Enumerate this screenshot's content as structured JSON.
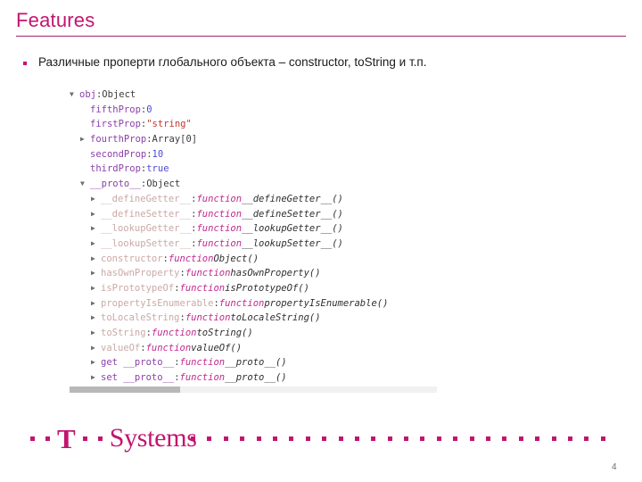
{
  "slide": {
    "title": "Features",
    "page_number": "4",
    "accent_color": "#c2156e",
    "rule_color": "#a3216b"
  },
  "bullet": {
    "marker": "square-bullet",
    "text": "Различные проперти глобального объекта – constructor, toString и т.п."
  },
  "console": {
    "scrollbar": {
      "orientation": "horizontal",
      "thumb_position": "left"
    },
    "lines": [
      {
        "twisty": "open",
        "indent": 0,
        "key": "obj",
        "key_style": "prop",
        "sep": ": ",
        "value": "Object",
        "value_style": "obj"
      },
      {
        "twisty": "none",
        "indent": 1,
        "key": "fifthProp",
        "key_style": "prop",
        "sep": ": ",
        "value": "0",
        "value_style": "num"
      },
      {
        "twisty": "none",
        "indent": 1,
        "key": "firstProp",
        "key_style": "prop",
        "sep": ": ",
        "value": "\"string\"",
        "value_style": "str"
      },
      {
        "twisty": "closed",
        "indent": 1,
        "key": "fourthProp",
        "key_style": "prop",
        "sep": ": ",
        "value": "Array[0]",
        "value_style": "obj"
      },
      {
        "twisty": "none",
        "indent": 1,
        "key": "secondProp",
        "key_style": "prop",
        "sep": ": ",
        "value": "10",
        "value_style": "num"
      },
      {
        "twisty": "none",
        "indent": 1,
        "key": "thirdProp",
        "key_style": "prop",
        "sep": ": ",
        "value": "true",
        "value_style": "bool"
      },
      {
        "twisty": "open",
        "indent": 1,
        "key": "__proto__",
        "key_style": "prop",
        "sep": ": ",
        "value": "Object",
        "value_style": "obj"
      },
      {
        "twisty": "closed",
        "indent": 2,
        "key": "__defineGetter__",
        "key_style": "proto",
        "sep": ": ",
        "fn_keyword": "function",
        "fn_name": "__defineGetter__()"
      },
      {
        "twisty": "closed",
        "indent": 2,
        "key": "__defineSetter__",
        "key_style": "proto",
        "sep": ": ",
        "fn_keyword": "function",
        "fn_name": "__defineSetter__()"
      },
      {
        "twisty": "closed",
        "indent": 2,
        "key": "__lookupGetter__",
        "key_style": "proto",
        "sep": ": ",
        "fn_keyword": "function",
        "fn_name": "__lookupGetter__()"
      },
      {
        "twisty": "closed",
        "indent": 2,
        "key": "__lookupSetter__",
        "key_style": "proto",
        "sep": ": ",
        "fn_keyword": "function",
        "fn_name": "__lookupSetter__()"
      },
      {
        "twisty": "closed",
        "indent": 2,
        "key": "constructor",
        "key_style": "proto",
        "sep": ": ",
        "fn_keyword": "function",
        "fn_name": "Object()"
      },
      {
        "twisty": "closed",
        "indent": 2,
        "key": "hasOwnProperty",
        "key_style": "proto",
        "sep": ": ",
        "fn_keyword": "function",
        "fn_name": "hasOwnProperty()"
      },
      {
        "twisty": "closed",
        "indent": 2,
        "key": "isPrototypeOf",
        "key_style": "proto",
        "sep": ": ",
        "fn_keyword": "function",
        "fn_name": "isPrototypeOf()"
      },
      {
        "twisty": "closed",
        "indent": 2,
        "key": "propertyIsEnumerable",
        "key_style": "proto",
        "sep": ": ",
        "fn_keyword": "function",
        "fn_name": "propertyIsEnumerable()"
      },
      {
        "twisty": "closed",
        "indent": 2,
        "key": "toLocaleString",
        "key_style": "proto",
        "sep": ": ",
        "fn_keyword": "function",
        "fn_name": "toLocaleString()"
      },
      {
        "twisty": "closed",
        "indent": 2,
        "key": "toString",
        "key_style": "proto",
        "sep": ": ",
        "fn_keyword": "function",
        "fn_name": "toString()"
      },
      {
        "twisty": "closed",
        "indent": 2,
        "key": "valueOf",
        "key_style": "proto",
        "sep": ": ",
        "fn_keyword": "function",
        "fn_name": "valueOf()"
      },
      {
        "twisty": "closed",
        "indent": 2,
        "key": "get __proto__",
        "key_style": "prop",
        "sep": ": ",
        "fn_keyword": "function",
        "fn_name": "__proto__()"
      },
      {
        "twisty": "closed",
        "indent": 2,
        "key": "set __proto__",
        "key_style": "prop",
        "sep": ": ",
        "fn_keyword": "function",
        "fn_name": "__proto__()"
      }
    ]
  },
  "footer": {
    "logo_t": "T",
    "logo_word": "Systems",
    "dot_count": 26
  }
}
